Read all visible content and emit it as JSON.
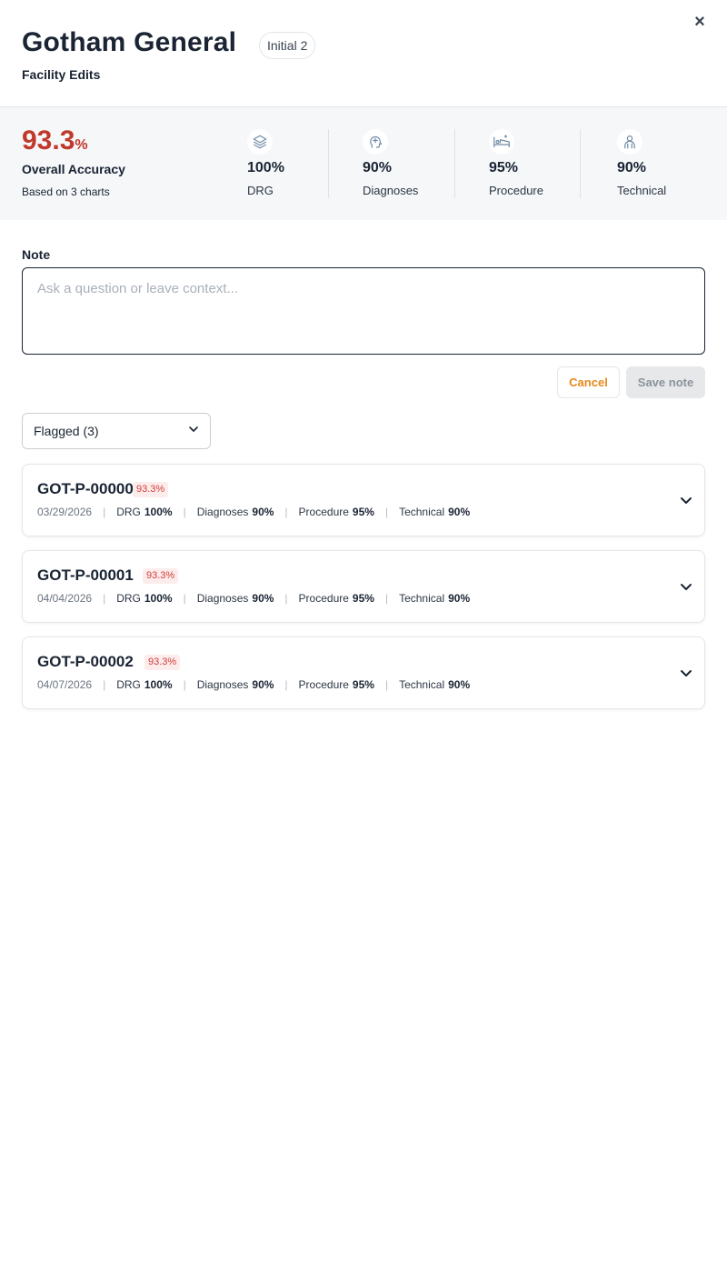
{
  "header": {
    "title": "Gotham General",
    "badge": "Initial 2",
    "subtitle": "Facility Edits",
    "close_icon": "×"
  },
  "summary": {
    "accuracy_value": "93.3",
    "accuracy_unit": "%",
    "accuracy_label": "Overall Accuracy",
    "based_on": "Based on 3 charts",
    "accent_color": "#c0392b",
    "metrics": [
      {
        "icon": "layers-icon",
        "value": "100%",
        "label": "DRG"
      },
      {
        "icon": "head-medical-icon",
        "value": "90%",
        "label": "Diagnoses"
      },
      {
        "icon": "hospital-bed-icon",
        "value": "95%",
        "label": "Procedure"
      },
      {
        "icon": "person-icon",
        "value": "90%",
        "label": "Technical"
      }
    ]
  },
  "note": {
    "label": "Note",
    "placeholder": "Ask a question or leave context...",
    "value": "",
    "cancel_label": "Cancel",
    "save_label": "Save note"
  },
  "filter": {
    "selected": "Flagged (3)"
  },
  "charts": [
    {
      "id": "GOT-P-00000",
      "accuracy": "93.3%",
      "date": "03/29/2026",
      "drg_label": "DRG",
      "drg": "100%",
      "diagnoses_label": "Diagnoses",
      "diagnoses": "90%",
      "procedure_label": "Procedure",
      "procedure": "95%",
      "technical_label": "Technical",
      "technical": "90%"
    },
    {
      "id": "GOT-P-00001",
      "accuracy": "93.3%",
      "date": "04/04/2026",
      "drg_label": "DRG",
      "drg": "100%",
      "diagnoses_label": "Diagnoses",
      "diagnoses": "90%",
      "procedure_label": "Procedure",
      "procedure": "95%",
      "technical_label": "Technical",
      "technical": "90%"
    },
    {
      "id": "GOT-P-00002",
      "accuracy": "93.3%",
      "date": "04/07/2026",
      "drg_label": "DRG",
      "drg": "100%",
      "diagnoses_label": "Diagnoses",
      "diagnoses": "90%",
      "procedure_label": "Procedure",
      "procedure": "95%",
      "technical_label": "Technical",
      "technical": "90%"
    }
  ]
}
